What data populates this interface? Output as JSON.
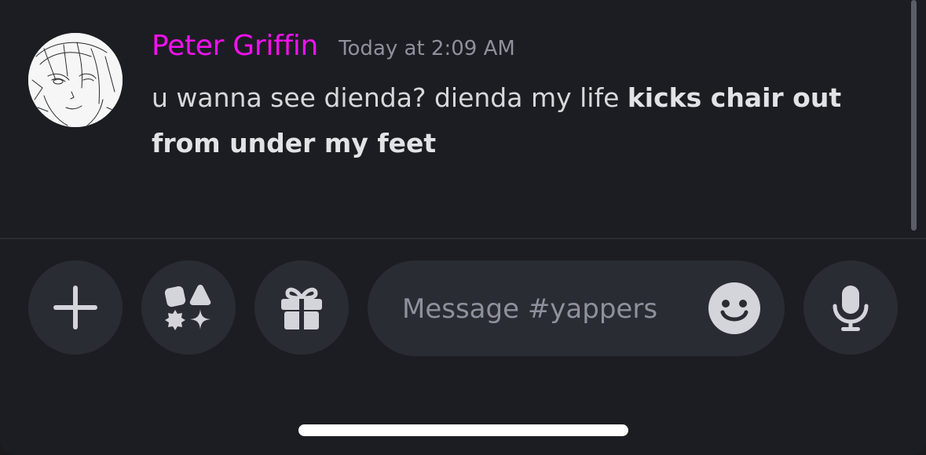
{
  "message": {
    "username": "Peter Griffin",
    "username_color": "#f311ef",
    "timestamp": "Today at 2:09 AM",
    "text_plain": "u wanna see dienda? dienda my life ",
    "text_bold": "kicks chair out from under my feet"
  },
  "composer": {
    "placeholder": "Message #yappers"
  },
  "icons": {
    "add": "plus-icon",
    "apps": "apps-shapes-icon",
    "gift": "gift-icon",
    "emoji": "smiley-face-icon",
    "voice": "microphone-icon"
  },
  "colors": {
    "background": "#1c1d22",
    "button": "#2a2c33",
    "text": "#d7d8dc",
    "muted": "#8e919c"
  }
}
